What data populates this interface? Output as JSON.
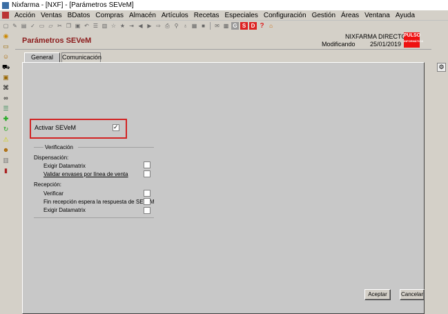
{
  "window": {
    "title": "Nixfarma - [NXF] - [Parámetros SEVeM]"
  },
  "menu": [
    "Acción",
    "Ventas",
    "BDatos",
    "Compras",
    "Almacén",
    "Artículos",
    "Recetas",
    "Especiales",
    "Configuración",
    "Gestión",
    "Áreas",
    "Ventana",
    "Ayuda"
  ],
  "toolbar": {
    "icons": [
      "new-icon",
      "edit-icon",
      "save-icon",
      "check-icon",
      "folder-icon",
      "open-icon",
      "cut-icon",
      "copy-icon",
      "paste-icon",
      "undo-icon",
      "list-icon",
      "print-icon",
      "star-icon",
      "star-filled-icon",
      "exit-icon",
      "left-arrow-icon",
      "right-arrow-icon",
      "go-icon",
      "printer-icon",
      "search-icon",
      "pin-icon",
      "calc-icon",
      "stop-icon",
      "notes-icon",
      "grid-icon",
      "g-icon",
      "s-icon",
      "d-icon",
      "help-icon",
      "home-icon"
    ],
    "g_label": "G",
    "s_label": "S",
    "d_label": "D",
    "help_label": "?"
  },
  "form": {
    "title": "Parámetros SEVeM",
    "company": "NIXFARMA DIRECTO",
    "status": "Modificando",
    "date": "25/01/2019",
    "logo_text": "PULSO",
    "logo_sub": "INFORMÁTICA",
    "tabs": [
      "General",
      "Comunicación"
    ],
    "activar_label": "Activar SEVeM",
    "activar_checked": true,
    "group_title": "Verificación",
    "dispensacion_label": "Dispensación:",
    "disp_items": [
      {
        "label": "Exigir Datamatrix",
        "checked": false
      },
      {
        "label": "Validar envases por línea de venta",
        "checked": false
      }
    ],
    "recepcion_label": "Recepción:",
    "recep_items": [
      {
        "label": "Verificar",
        "checked": false
      },
      {
        "label": "Fin recepción espera la respuesta de SEVeM",
        "checked": false
      },
      {
        "label": "Exigir Datamatrix",
        "checked": false
      }
    ],
    "accept_label": "Aceptar",
    "cancel_label": "Cancelar"
  },
  "colors": {
    "title": "#8b1a1a",
    "highlight": "#d22222",
    "logo": "#ee1111"
  }
}
